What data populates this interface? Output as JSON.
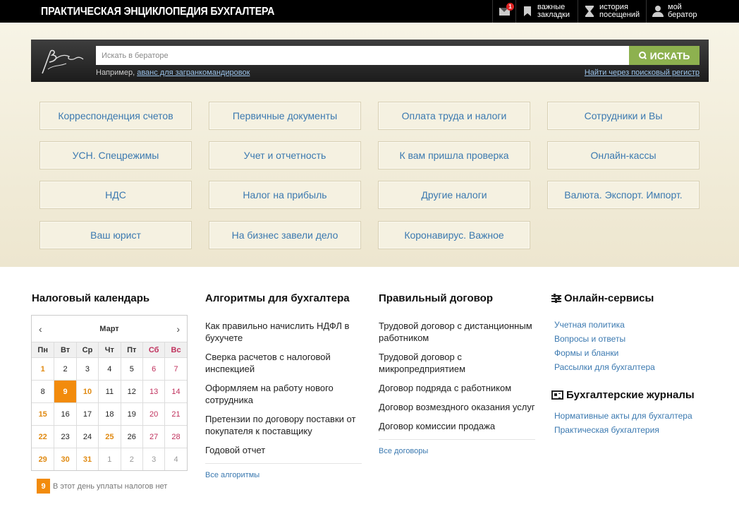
{
  "header": {
    "brand": "ПРАКТИЧЕСКАЯ ЭНЦИКЛОПЕДИЯ БУХГАЛТЕРА",
    "mail_badge": "1",
    "bookmarks_line1": "важные",
    "bookmarks_line2": "закладки",
    "history_line1": "история",
    "history_line2": "посещений",
    "account_line1": "мой",
    "account_line2": "бератор"
  },
  "search": {
    "logo_text": "Бератор",
    "placeholder": "Искать в бераторе",
    "button": "ИСКАТЬ",
    "example_prefix": "Например,",
    "example_link": "аванс для загранкомандировок",
    "register_link": "Найти через поисковый регистр"
  },
  "categories": [
    "Корреспонденция счетов",
    "Первичные документы",
    "Оплата труда и налоги",
    "Сотрудники и Вы",
    "УСН. Спецрежимы",
    "Учет и отчетность",
    "К вам пришла проверка",
    "Онлайн-кассы",
    "НДС",
    "Налог на прибыль",
    "Другие налоги",
    "Валюта. Экспорт. Импорт.",
    "Ваш юрист",
    "На бизнес завели дело",
    "Коронавирус. Важное"
  ],
  "calendar": {
    "title": "Налоговый календарь",
    "month": "Март",
    "prev": "‹",
    "next": "›",
    "weekdays": [
      "Пн",
      "Вт",
      "Ср",
      "Чт",
      "Пт",
      "Сб",
      "Вс"
    ],
    "days": [
      "1",
      "2",
      "3",
      "4",
      "5",
      "6",
      "7",
      "8",
      "9",
      "10",
      "11",
      "12",
      "13",
      "14",
      "15",
      "16",
      "17",
      "18",
      "19",
      "20",
      "21",
      "22",
      "23",
      "24",
      "25",
      "26",
      "27",
      "28",
      "29",
      "30",
      "31",
      "1",
      "2",
      "3",
      "4"
    ],
    "legend_day": "9",
    "legend_text": "В этот день уплаты налогов нет"
  },
  "algorithms": {
    "title": "Алгоритмы для бухгалтера",
    "items": [
      "Как правильно начислить НДФЛ в бухучете",
      "Сверка расчетов с налоговой инспекцией",
      "Оформляем на работу нового сотрудника",
      "Претензии по договору поставки от покупателя к поставщику",
      "Годовой отчет"
    ],
    "all": "Все алгоритмы"
  },
  "contracts": {
    "title": "Правильный договор",
    "items": [
      "Трудовой договор с дистанционным работником",
      "Трудовой договор с микропредприятием",
      "Договор подряда с работником",
      "Договор возмездного оказания услуг",
      "Договор комиссии продажа"
    ],
    "all": "Все договоры"
  },
  "services": {
    "title": "Онлайн-сервисы",
    "items": [
      "Учетная политика",
      "Вопросы и ответы",
      "Формы и бланки",
      "Рассылки для бухгалтера"
    ]
  },
  "journals": {
    "title": "Бухгалтерские журналы",
    "items": [
      "Нормативные акты для бухгалтера",
      "Практическая бухгалтерия"
    ]
  }
}
